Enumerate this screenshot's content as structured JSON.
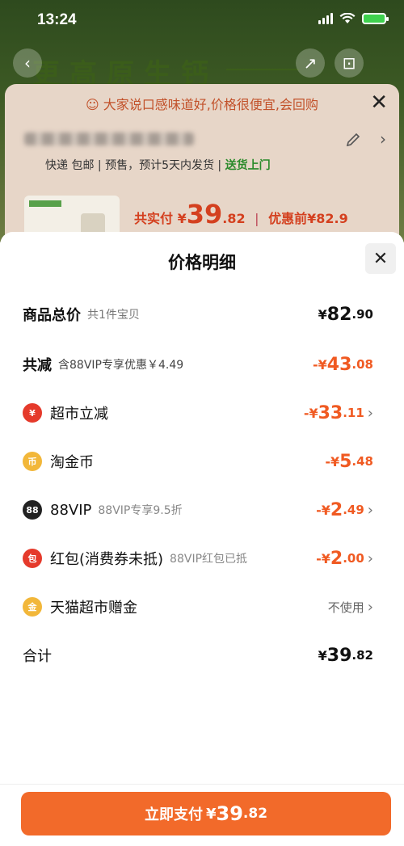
{
  "status_bar": {
    "time": "13:24"
  },
  "background": {
    "banner_text": "更高原生钙",
    "review_prompt": "大家说口感味道好,价格很便宜,会回购",
    "shipping_text": "快递 包邮 | 预售，预计5天内发货 |",
    "shipping_highlight": "送货上门",
    "total_label": "共实付 ¥",
    "total_int": "39",
    "total_dec": ".82",
    "separator": "|",
    "original_price": "优惠前¥82.9"
  },
  "sheet": {
    "title": "价格明细",
    "close_glyph": "✕",
    "rows": {
      "total_price": {
        "label": "商品总价",
        "sub": "共1件宝贝",
        "sym": "¥",
        "int": "82",
        "dec": ".90"
      },
      "discount": {
        "label": "共减",
        "sub": "含88VIP专享优惠￥4.49",
        "sym": "-¥",
        "int": "43",
        "dec": ".08"
      },
      "supermarket": {
        "label": "超市立减",
        "icon_text": "¥",
        "sym": "-¥",
        "int": "33",
        "dec": ".11",
        "chevron": "›"
      },
      "gold_coin": {
        "label": "淘金币",
        "icon_text": "币",
        "sym": "-¥",
        "int": "5",
        "dec": ".48"
      },
      "vip": {
        "label": "88VIP",
        "sub": "88VIP专享9.5折",
        "icon_text": "88",
        "sym": "-¥",
        "int": "2",
        "dec": ".49",
        "chevron": "›"
      },
      "red_packet": {
        "label": "红包(消费券未抵)",
        "sub": "88VIP红包已抵",
        "icon_text": "包",
        "sym": "-¥",
        "int": "2",
        "dec": ".00",
        "chevron": "›"
      },
      "tmall_gift": {
        "label": "天猫超市赠金",
        "icon_text": "金",
        "value": "不使用",
        "chevron": "›"
      },
      "sum": {
        "label": "合计",
        "sym": "¥",
        "int": "39",
        "dec": ".82"
      }
    }
  },
  "pay_button": {
    "label": "立即支付",
    "sym": "¥",
    "int": "39",
    "dec": ".82"
  },
  "colors": {
    "accent": "#f26a2a",
    "discount": "#f05a22",
    "icon_red": "#e53a2b",
    "icon_gold": "#f2b73a"
  }
}
